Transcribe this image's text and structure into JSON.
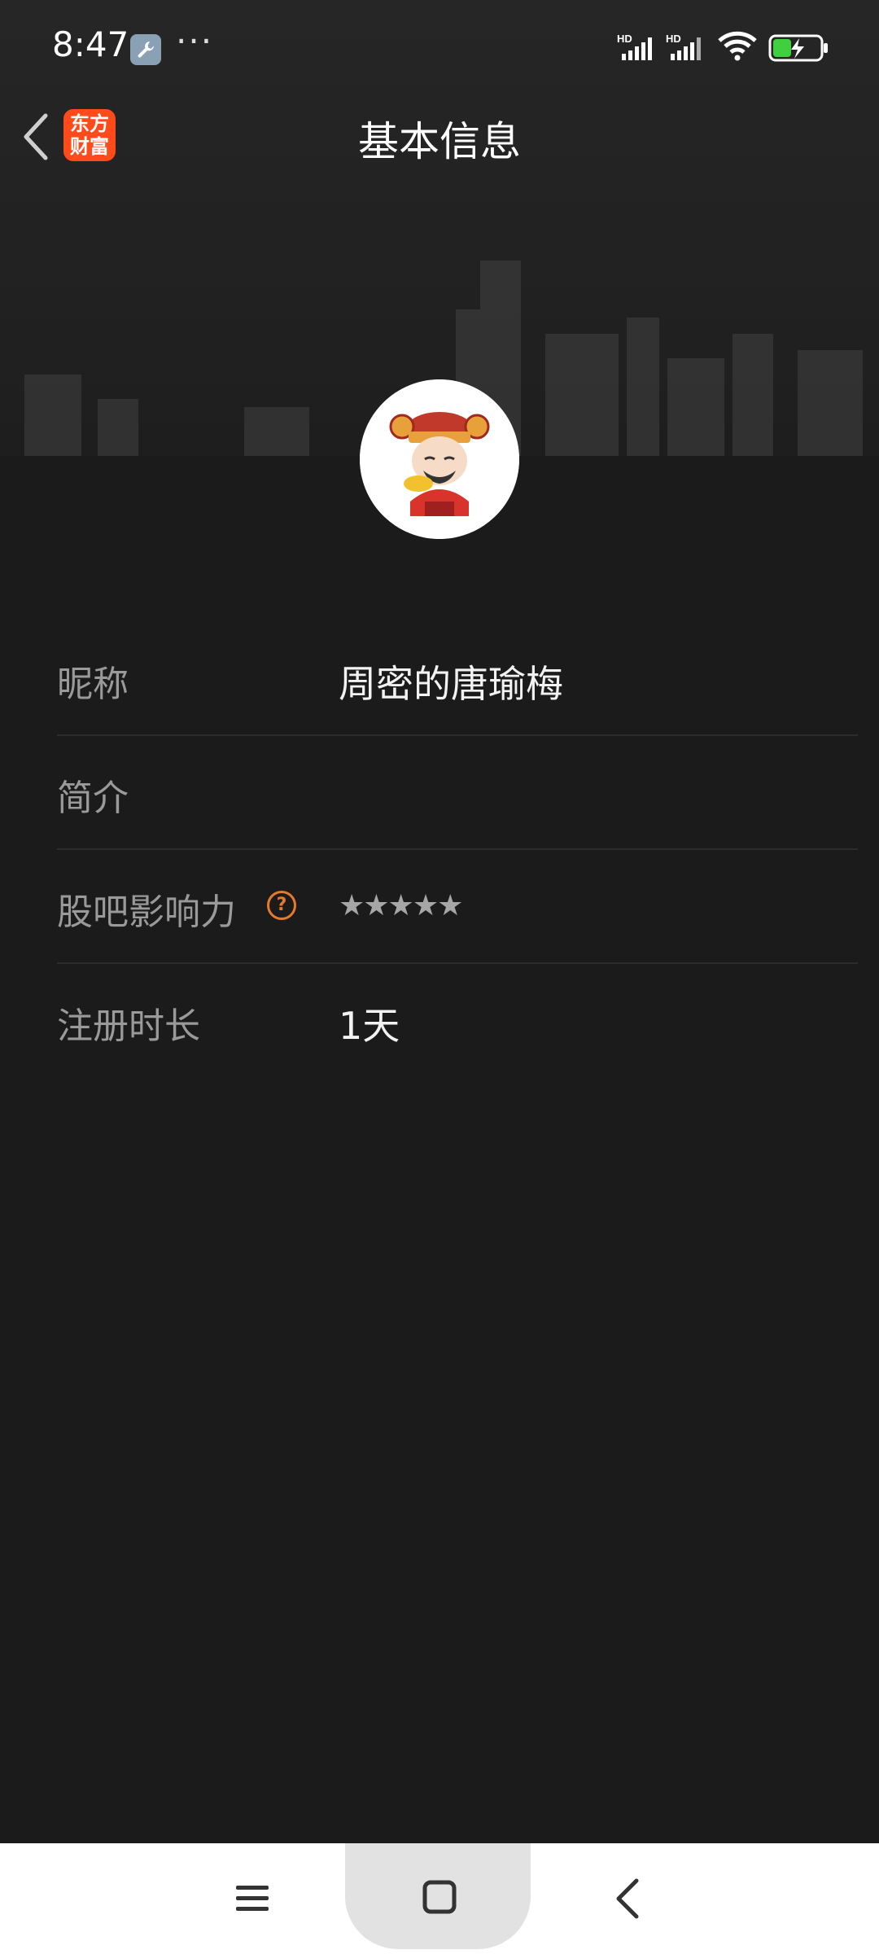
{
  "status_bar": {
    "time": "8:47",
    "more": "···",
    "signal1_label": "HD",
    "signal2_label": "HD"
  },
  "header": {
    "title": "基本信息",
    "app_logo_line1": "东方",
    "app_logo_line2": "财富"
  },
  "profile": {
    "rows": [
      {
        "label": "昵称",
        "value": "周密的唐瑜梅"
      },
      {
        "label": "简介",
        "value": ""
      },
      {
        "label": "股吧影响力",
        "value": "★★★★★",
        "help": "?"
      },
      {
        "label": "注册时长",
        "value": "1天"
      }
    ]
  },
  "colors": {
    "background": "#1b1b1b",
    "accent_orange": "#e67a2a",
    "logo_red": "#ff4a19"
  }
}
